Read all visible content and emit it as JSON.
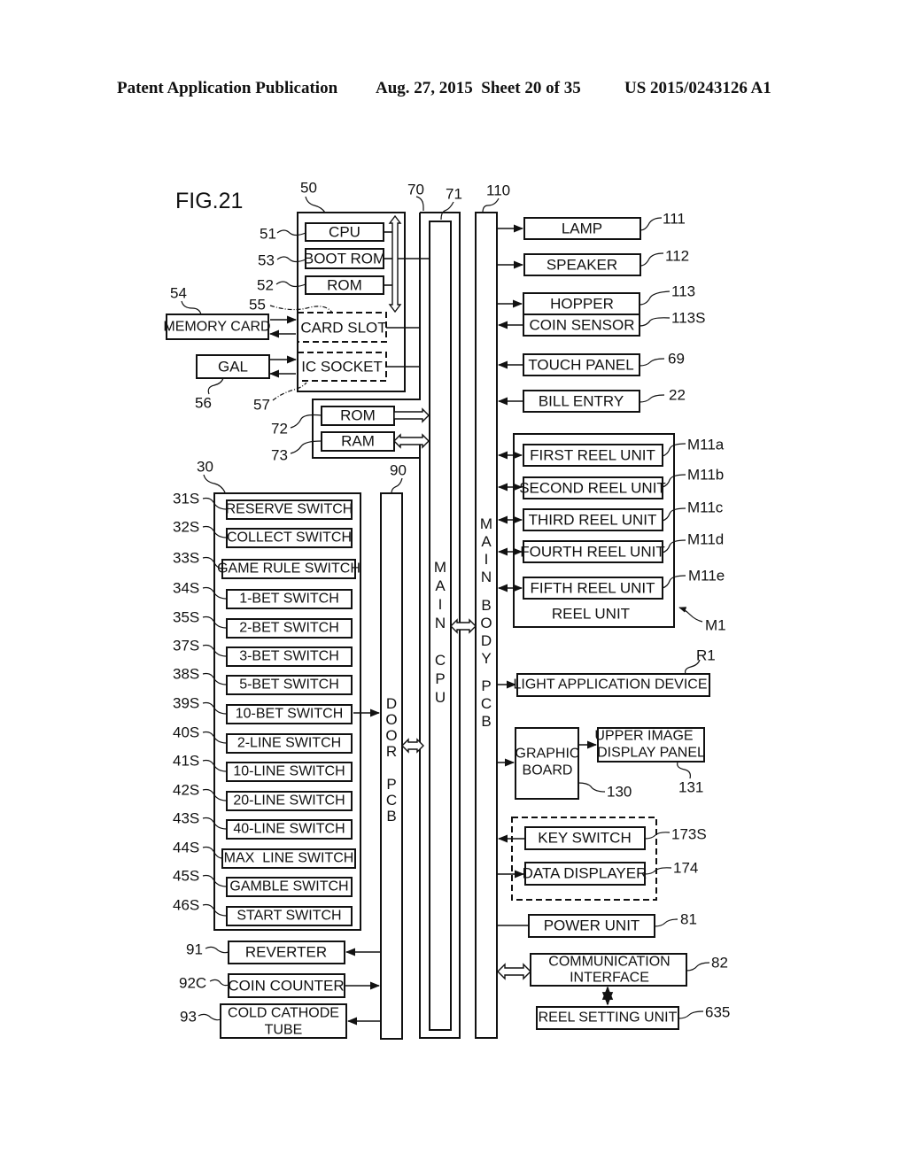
{
  "header": {
    "publication": "Patent Application Publication",
    "date_sheet": "Aug. 27, 2015  Sheet 20 of 35",
    "patent_number": "US 2015/0243126 A1"
  },
  "figure": {
    "title": "FIG.21",
    "main_ref": {
      "board_50": "50",
      "bus_70": "70",
      "cpu_71": "71",
      "main_body_110": "110",
      "door_90": "90",
      "switches_30": "30"
    },
    "main_cpu_label": [
      "M",
      "A",
      "I",
      "N",
      "",
      "C",
      "P",
      "U"
    ],
    "main_body_label": [
      "M",
      "A",
      "I",
      "N",
      "",
      "B",
      "O",
      "D",
      "Y",
      "",
      "P",
      "C",
      "B"
    ],
    "door_pcb_label": [
      "D",
      "O",
      "O",
      "R",
      "",
      "P",
      "C",
      "B"
    ],
    "gal_board": [
      {
        "label": "CPU",
        "ref": "51"
      },
      {
        "label": "BOOT ROM",
        "ref": "53"
      },
      {
        "label": "ROM",
        "ref": "52"
      },
      {
        "label": "CARD SLOT",
        "ref": "55"
      },
      {
        "label": "IC SOCKET",
        "ref": "57"
      }
    ],
    "external_left": [
      {
        "label": "MEMORY CARD",
        "ref": "54"
      },
      {
        "label": "GAL",
        "ref": "56"
      }
    ],
    "memory": [
      {
        "label": "ROM",
        "ref": "72"
      },
      {
        "label": "RAM",
        "ref": "73"
      }
    ],
    "right_devices": [
      {
        "label": "LAMP",
        "ref": "111"
      },
      {
        "label": "SPEAKER",
        "ref": "112"
      },
      {
        "label": "HOPPER",
        "ref": "113"
      },
      {
        "label": "COIN SENSOR",
        "ref": "113S"
      },
      {
        "label": "TOUCH PANEL",
        "ref": "69"
      },
      {
        "label": "BILL ENTRY",
        "ref": "22"
      }
    ],
    "reel_unit": {
      "label": "REEL UNIT",
      "ref": "M1",
      "units": [
        {
          "label": "FIRST REEL UNIT",
          "ref": "M11a"
        },
        {
          "label": "SECOND REEL UNIT",
          "ref": "M11b"
        },
        {
          "label": "THIRD REEL UNIT",
          "ref": "M11c"
        },
        {
          "label": "FOURTH REEL UNIT",
          "ref": "M11d"
        },
        {
          "label": "FIFTH REEL UNIT",
          "ref": "M11e"
        }
      ]
    },
    "light_device": {
      "label": "LIGHT APPLICATION DEVICE",
      "ref": "R1"
    },
    "graphic_board": {
      "label": [
        "GRAPHIC",
        "BOARD"
      ],
      "ref": "130"
    },
    "upper_display": {
      "label": [
        "UPPER IMAGE",
        "DISPLAY PANEL"
      ],
      "ref": "131"
    },
    "key_switch": {
      "label": "KEY SWITCH",
      "ref": "173S"
    },
    "data_displayer": {
      "label": "DATA DISPLAYER",
      "ref": "174"
    },
    "power_unit": {
      "label": "POWER UNIT",
      "ref": "81"
    },
    "comm_interface": {
      "label": [
        "COMMUNICATION",
        "INTERFACE"
      ],
      "ref": "82"
    },
    "reel_setting": {
      "label": "REEL SETTING UNIT",
      "ref": "635"
    },
    "switches": [
      {
        "label": "RESERVE SWITCH",
        "ref": "31S"
      },
      {
        "label": "COLLECT SWITCH",
        "ref": "32S"
      },
      {
        "label": "GAME RULE SWITCH",
        "ref": "33S"
      },
      {
        "label": "1-BET SWITCH",
        "ref": "34S"
      },
      {
        "label": "2-BET SWITCH",
        "ref": "35S"
      },
      {
        "label": "3-BET SWITCH",
        "ref": "37S"
      },
      {
        "label": "5-BET SWITCH",
        "ref": "38S"
      },
      {
        "label": "10-BET SWITCH",
        "ref": "39S"
      },
      {
        "label": "2-LINE SWITCH",
        "ref": "40S"
      },
      {
        "label": "10-LINE SWITCH",
        "ref": "41S"
      },
      {
        "label": "20-LINE SWITCH",
        "ref": "42S"
      },
      {
        "label": "40-LINE SWITCH",
        "ref": "43S"
      },
      {
        "label": "MAX  LINE SWITCH",
        "ref": "44S"
      },
      {
        "label": "GAMBLE SWITCH",
        "ref": "45S"
      },
      {
        "label": "START SWITCH",
        "ref": "46S"
      }
    ],
    "door_outputs": [
      {
        "label": "REVERTER",
        "ref": "91"
      },
      {
        "label": "COIN COUNTER",
        "ref": "92C"
      },
      {
        "label": [
          "COLD CATHODE",
          "TUBE"
        ],
        "ref": "93"
      }
    ]
  }
}
